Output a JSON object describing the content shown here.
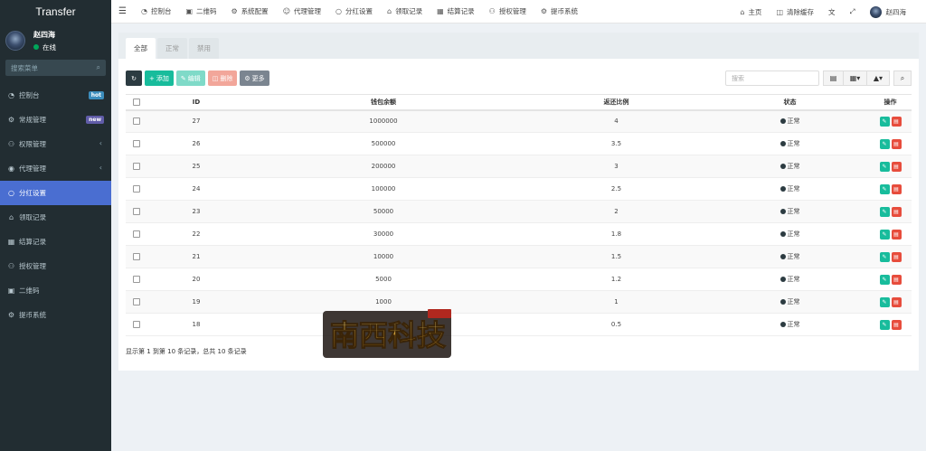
{
  "sidebar": {
    "brand": "Transfer",
    "user_name": "赵四海",
    "user_status": "在线",
    "search_placeholder": "搜索菜单",
    "items": [
      {
        "label": "控制台",
        "icon": "dashboard-icon",
        "badge": "hot"
      },
      {
        "label": "常规管理",
        "icon": "cogs-icon",
        "badge": "new"
      },
      {
        "label": "权限管理",
        "icon": "group-icon",
        "chevron": true
      },
      {
        "label": "代理管理",
        "icon": "user-circle-icon",
        "chevron": true
      },
      {
        "label": "分红设置",
        "icon": "circle-icon",
        "active": true
      },
      {
        "label": "领取记录",
        "icon": "bank-icon"
      },
      {
        "label": "结算记录",
        "icon": "calculator-icon"
      },
      {
        "label": "授权管理",
        "icon": "users-icon"
      },
      {
        "label": "二维码",
        "icon": "qrcode-icon"
      },
      {
        "label": "提币系统",
        "icon": "gear-icon"
      }
    ]
  },
  "navbar": {
    "items": [
      {
        "label": "控制台",
        "icon": "dashboard-icon"
      },
      {
        "label": "二维码",
        "icon": "qrcode-icon"
      },
      {
        "label": "系统配置",
        "icon": "gear-icon"
      },
      {
        "label": "代理管理",
        "icon": "user-icon"
      },
      {
        "label": "分红设置",
        "icon": "circle-icon"
      },
      {
        "label": "领取记录",
        "icon": "bank-icon"
      },
      {
        "label": "结算记录",
        "icon": "calculator-icon"
      },
      {
        "label": "授权管理",
        "icon": "users-icon"
      },
      {
        "label": "提币系统",
        "icon": "gear-icon"
      }
    ],
    "home": "主页",
    "clear_cache": "清除缓存",
    "user": "赵四海"
  },
  "tabs": [
    "全部",
    "正常",
    "禁用"
  ],
  "toolbar": {
    "add": "添加",
    "edit": "编辑",
    "delete": "删除",
    "more": "更多",
    "search_placeholder": "搜索"
  },
  "table": {
    "headers": [
      "ID",
      "钱包余额",
      "返还比例",
      "状态",
      "操作"
    ],
    "rows": [
      {
        "id": "27",
        "balance": "1000000",
        "ratio": "4",
        "status": "正常"
      },
      {
        "id": "26",
        "balance": "500000",
        "ratio": "3.5",
        "status": "正常"
      },
      {
        "id": "25",
        "balance": "200000",
        "ratio": "3",
        "status": "正常"
      },
      {
        "id": "24",
        "balance": "100000",
        "ratio": "2.5",
        "status": "正常"
      },
      {
        "id": "23",
        "balance": "50000",
        "ratio": "2",
        "status": "正常"
      },
      {
        "id": "22",
        "balance": "30000",
        "ratio": "1.8",
        "status": "正常"
      },
      {
        "id": "21",
        "balance": "10000",
        "ratio": "1.5",
        "status": "正常"
      },
      {
        "id": "20",
        "balance": "5000",
        "ratio": "1.2",
        "status": "正常"
      },
      {
        "id": "19",
        "balance": "1000",
        "ratio": "1",
        "status": "正常"
      },
      {
        "id": "18",
        "balance": "",
        "ratio": "0.5",
        "status": "正常"
      }
    ]
  },
  "footer": "显示第 1 到第 10 条记录，总共 10 条记录",
  "watermark_text": "南西科技"
}
